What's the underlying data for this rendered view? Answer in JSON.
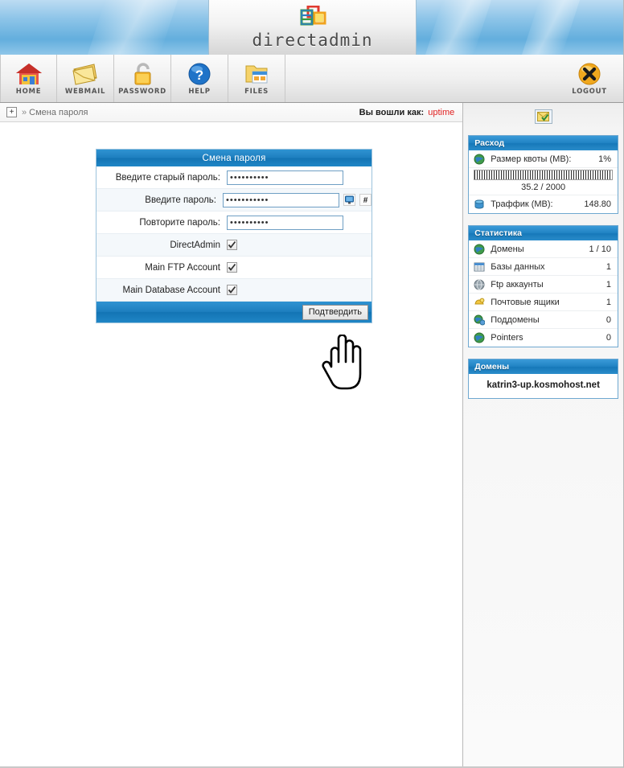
{
  "brand": {
    "name": "directadmin"
  },
  "toolbar": {
    "items": [
      {
        "label": "HOME",
        "icon": "house-icon"
      },
      {
        "label": "WEBMAIL",
        "icon": "envelope-icon"
      },
      {
        "label": "PASSWORD",
        "icon": "padlock-icon"
      },
      {
        "label": "HELP",
        "icon": "question-mark-icon"
      },
      {
        "label": "FILES",
        "icon": "folder-files-icon"
      }
    ],
    "logout": {
      "label": "LOGOUT",
      "icon": "close-circle-icon"
    }
  },
  "breadcrumb": {
    "expand_label": "+",
    "separator": "»",
    "title": "Смена пароля",
    "logged_in_label": "Вы вошли как:",
    "user": "uptime",
    "user_color": "#e02020"
  },
  "form": {
    "title": "Смена пароля",
    "rows": [
      {
        "label": "Введите старый пароль:",
        "value": "••••••••••"
      },
      {
        "label": "Введите пароль:",
        "value": "•••••••••••"
      },
      {
        "label": "Повторите пароль:",
        "value": "••••••••••"
      }
    ],
    "checkboxes": [
      {
        "label": "DirectAdmin",
        "checked": true
      },
      {
        "label": "Main FTP Account",
        "checked": true
      },
      {
        "label": "Main Database Account",
        "checked": true
      }
    ],
    "show_password_icon": "monitor-icon",
    "generate_password_icon": "hash-icon",
    "submit_label": "Подтвердить"
  },
  "sidebar": {
    "envelope_button_icon": "envelope-check-icon",
    "usage": {
      "title": "Расход",
      "quota_label": "Размер квоты (MB):",
      "quota_percent": "1%",
      "quota_percent_value": 1,
      "quota_text": "35.2 / 2000",
      "bandwidth_label": "Траффик (MB):",
      "bandwidth_value": "148.80"
    },
    "stats": {
      "title": "Статистика",
      "rows": [
        {
          "icon": "globe-icon",
          "label": "Домены",
          "value": "1 / 10"
        },
        {
          "icon": "database-icon",
          "label": "Базы данных",
          "value": "1"
        },
        {
          "icon": "ftp-globe-icon",
          "label": "Ftp аккаунты",
          "value": "1"
        },
        {
          "icon": "mailbox-icon",
          "label": "Почтовые ящики",
          "value": "1"
        },
        {
          "icon": "subdomain-icon",
          "label": "Поддомены",
          "value": "0"
        },
        {
          "icon": "pointer-icon",
          "label": "Pointers",
          "value": "0"
        }
      ]
    },
    "domains": {
      "title": "Домены",
      "name": "katrin3-up.kosmohost.net"
    }
  },
  "colors": {
    "accent_blue": "#1e7fbf",
    "banner_blue": "#8cc4e8",
    "user_red": "#e02020"
  }
}
